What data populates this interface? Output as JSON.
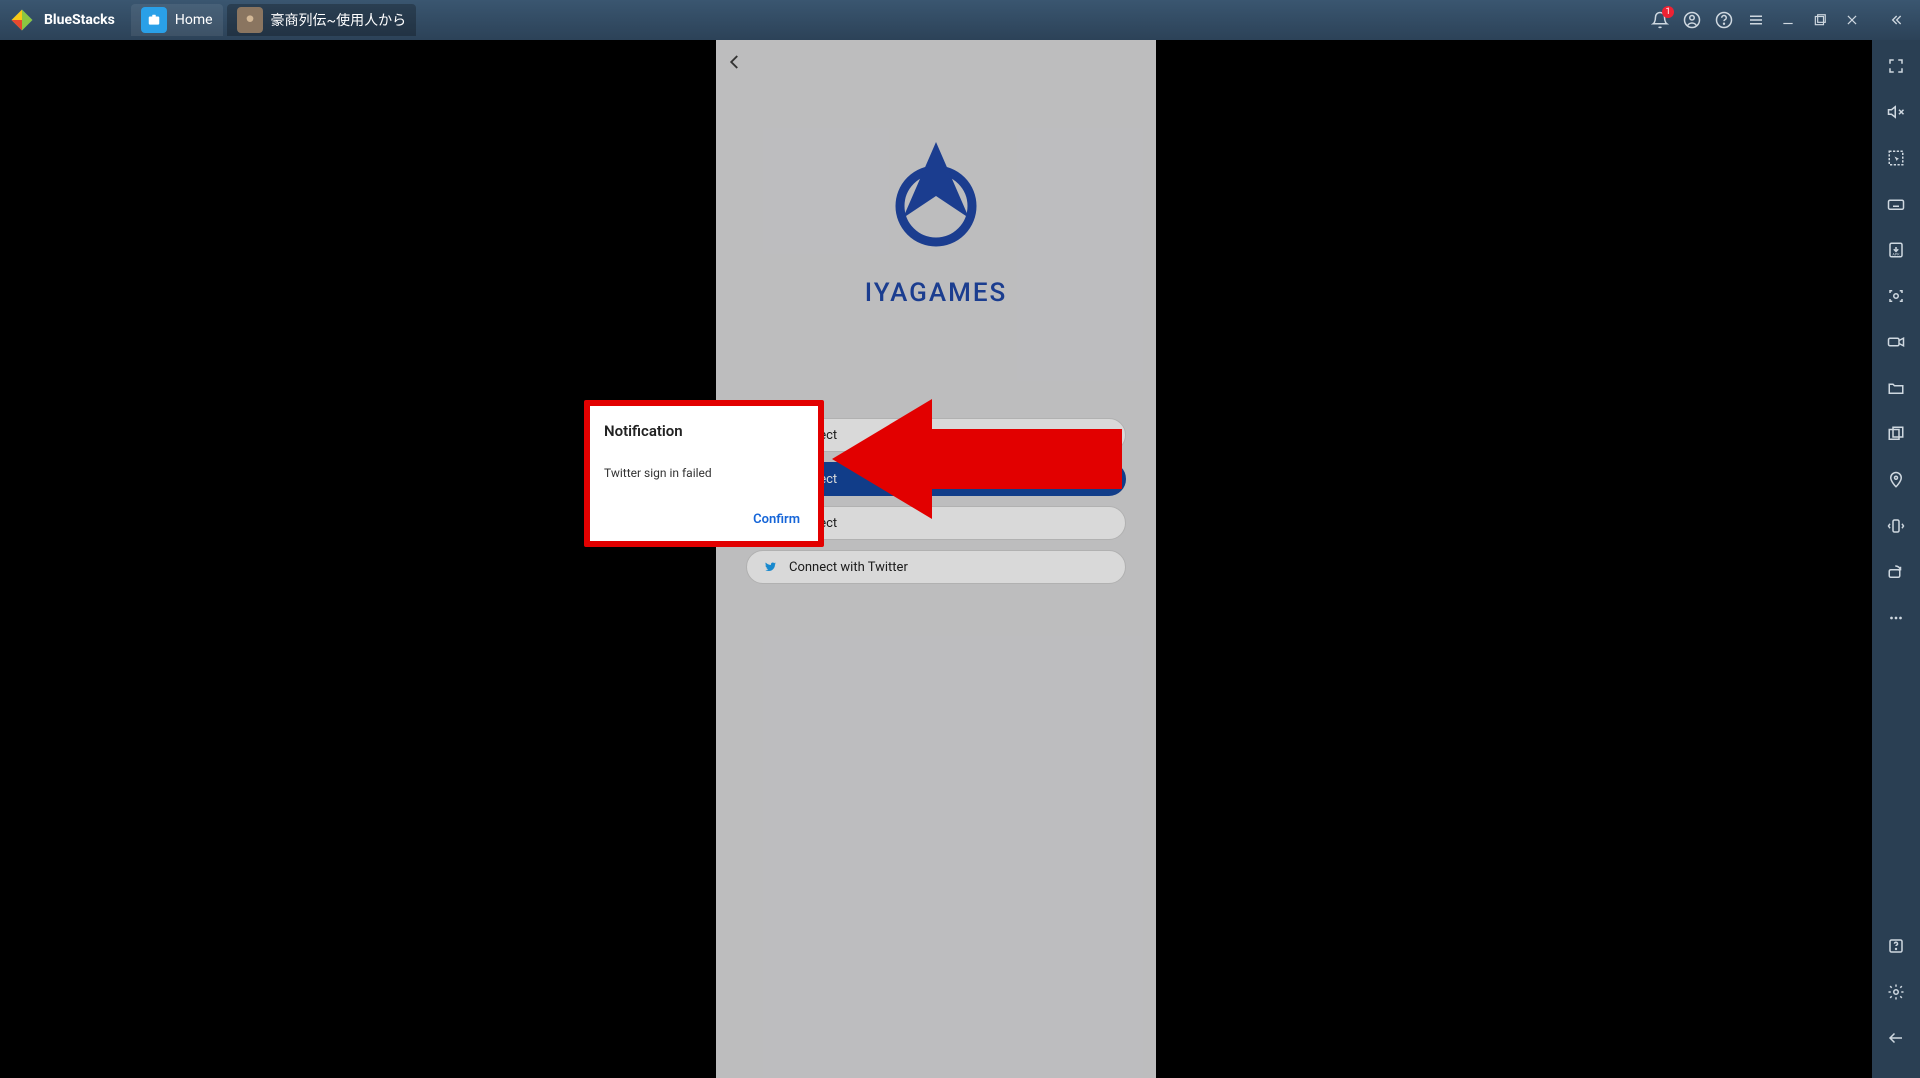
{
  "titlebar": {
    "product": "BlueStacks",
    "tabs": {
      "home": "Home",
      "app": "豪商列伝~使用人から"
    },
    "notif_badge": "1"
  },
  "phone": {
    "brand": "IYAGAMES",
    "connect": {
      "iya": "Connect",
      "fb": "Connect",
      "google": "Connect",
      "twitter": "Connect with Twitter"
    }
  },
  "dialog": {
    "title": "Notification",
    "message": "Twitter sign in failed",
    "confirm": "Confirm"
  }
}
